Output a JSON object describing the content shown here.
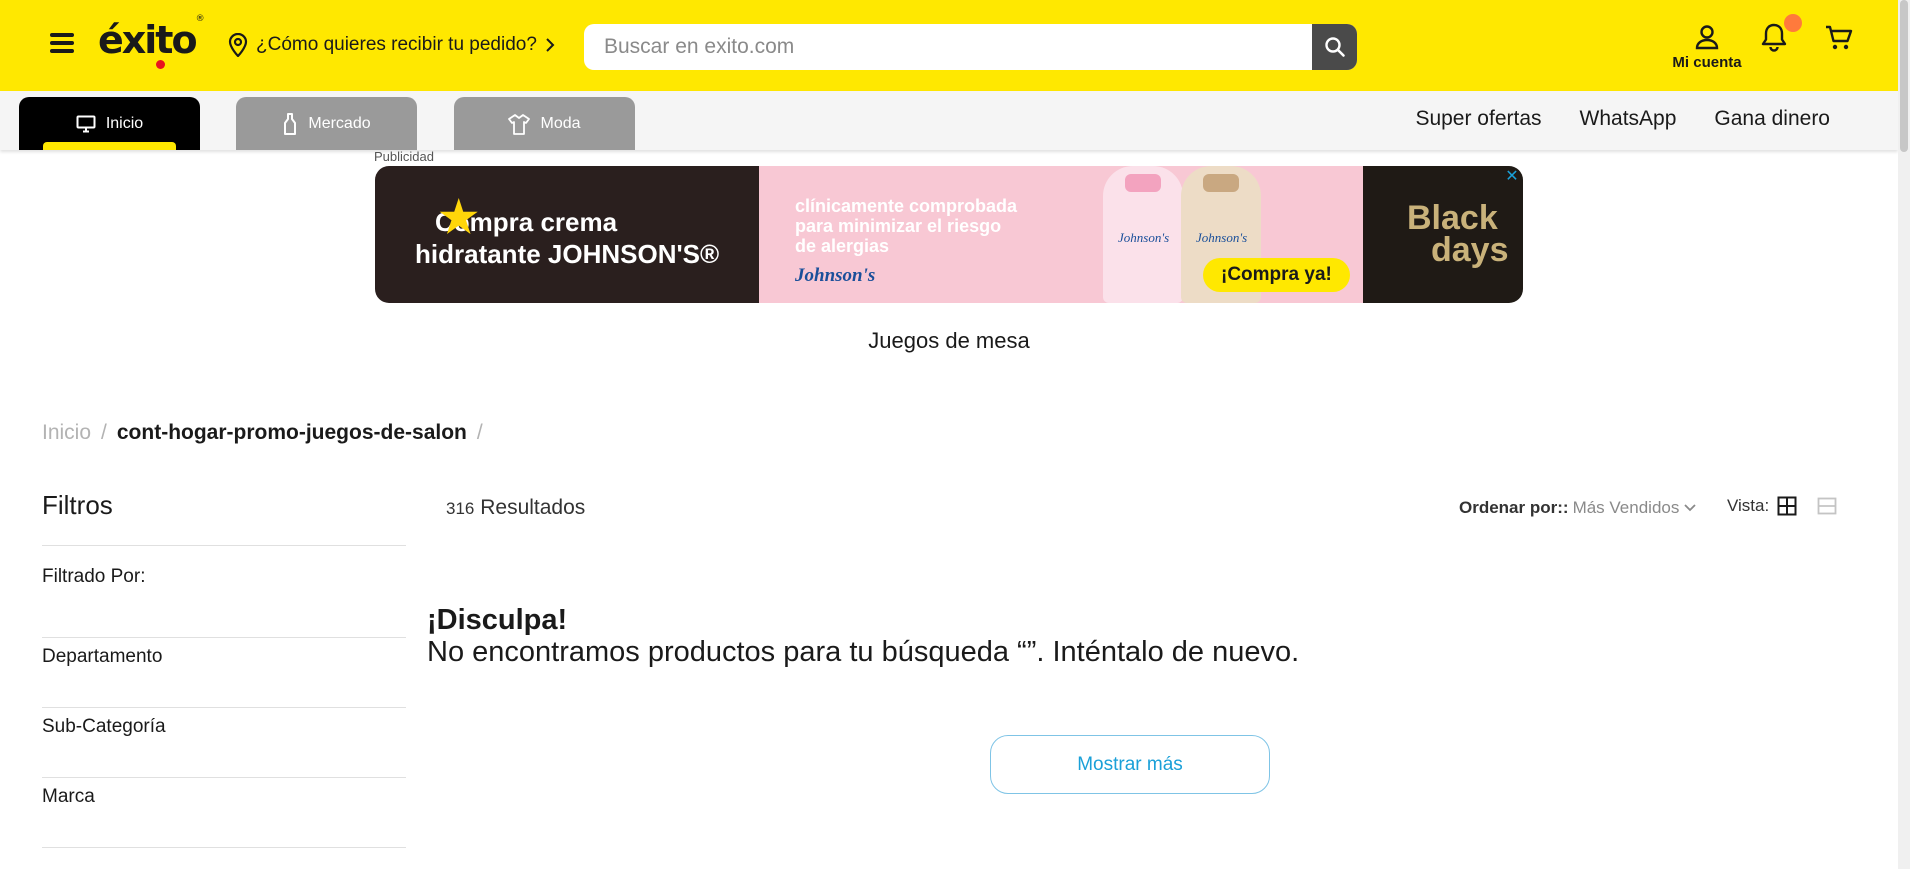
{
  "header": {
    "logo_text": "éxito",
    "logo_mark": "®",
    "delivery_text": "¿Cómo quieres recibir tu pedido?",
    "search_placeholder": "Buscar en exito.com",
    "account_label": "Mi cuenta",
    "brand_color": "#ffe800"
  },
  "tabs": [
    {
      "label": "Inicio",
      "icon": "monitor-icon",
      "active": true
    },
    {
      "label": "Mercado",
      "icon": "bottle-icon",
      "active": false
    },
    {
      "label": "Moda",
      "icon": "shirt-icon",
      "active": false
    }
  ],
  "nav_links": [
    "Super ofertas",
    "WhatsApp",
    "Gana dinero"
  ],
  "ad": {
    "label": "Publicidad",
    "headline_1": "Compra crema",
    "headline_2": "hidratante JOHNSON'S®",
    "claim_1": "clínicamente comprobada",
    "claim_2": "para minimizar el riesgo",
    "claim_3": "de alergias",
    "brand": "Johnson's",
    "bottle_label": "Johnson's",
    "cta": "¡Compra ya!",
    "promo_1": "Black",
    "promo_2": "days",
    "close": "✕"
  },
  "page_title": "Juegos de mesa",
  "breadcrumb": {
    "home": "Inicio",
    "separator": "/",
    "current": "cont-hogar-promo-juegos-de-salon"
  },
  "filters": {
    "title": "Filtros",
    "filtered_by": "Filtrado Por:",
    "items": [
      "Departamento",
      "Sub-Categoría",
      "Marca"
    ]
  },
  "results": {
    "count": "316",
    "label": "Resultados",
    "sort_label": "Ordenar por::",
    "sort_value": "Más Vendidos",
    "view_label": "Vista:"
  },
  "empty": {
    "title": "¡Disculpa!",
    "message": "No encontramos productos para tu búsqueda  “”. Inténtalo de nuevo."
  },
  "more_button": "Mostrar más"
}
